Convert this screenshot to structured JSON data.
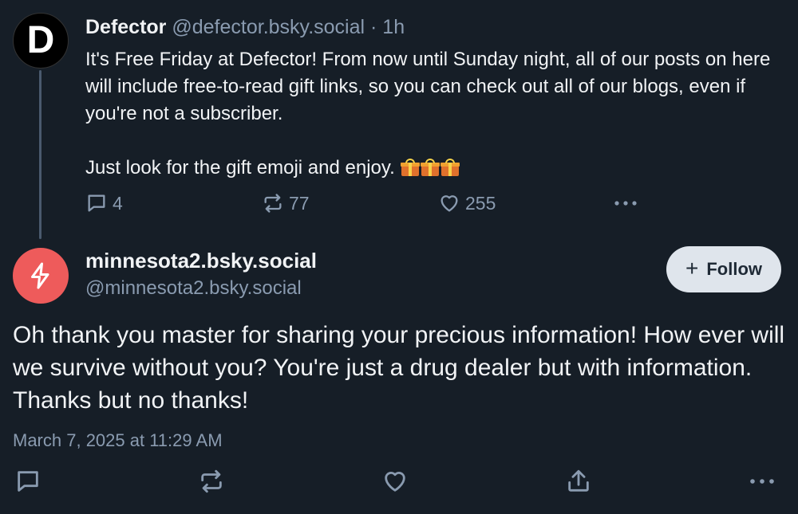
{
  "parent_post": {
    "author_initial": "D",
    "author_name": "Defector",
    "author_handle": "@defector.bsky.social",
    "separator": "·",
    "time_ago": "1h",
    "text_paragraph_1": "It's Free Friday at Defector! From now until Sunday night, all of our posts on here will include free-to-read gift links, so you can check out all of our blogs, even if you're not a subscriber.",
    "text_paragraph_2": "Just look for the gift emoji and enjoy.",
    "emoji": "🎁🎁🎁",
    "reply_count": "4",
    "repost_count": "77",
    "like_count": "255"
  },
  "reply_post": {
    "author_name": "minnesota2.bsky.social",
    "author_handle": "@minnesota2.bsky.social",
    "follow_label": "Follow",
    "text": "Oh thank you master for sharing your precious information!  How ever will we survive without you?  You're just a drug dealer but with information. Thanks but no thanks!",
    "timestamp": "March 7, 2025 at 11:29 AM"
  },
  "icons": {
    "reply": "speech-bubble-icon",
    "repost": "repost-arrows-icon",
    "like": "heart-icon",
    "share": "share-icon",
    "more": "ellipsis-icon",
    "avatar_reply": "lightning-icon"
  },
  "colors": {
    "background": "#161e27",
    "text_primary": "#f1f3f5",
    "text_muted": "#8a9bb0",
    "thread_line": "#4a5a6e",
    "follow_button_bg": "#dfe5ec",
    "reply_avatar_bg": "#ee5b5b"
  }
}
